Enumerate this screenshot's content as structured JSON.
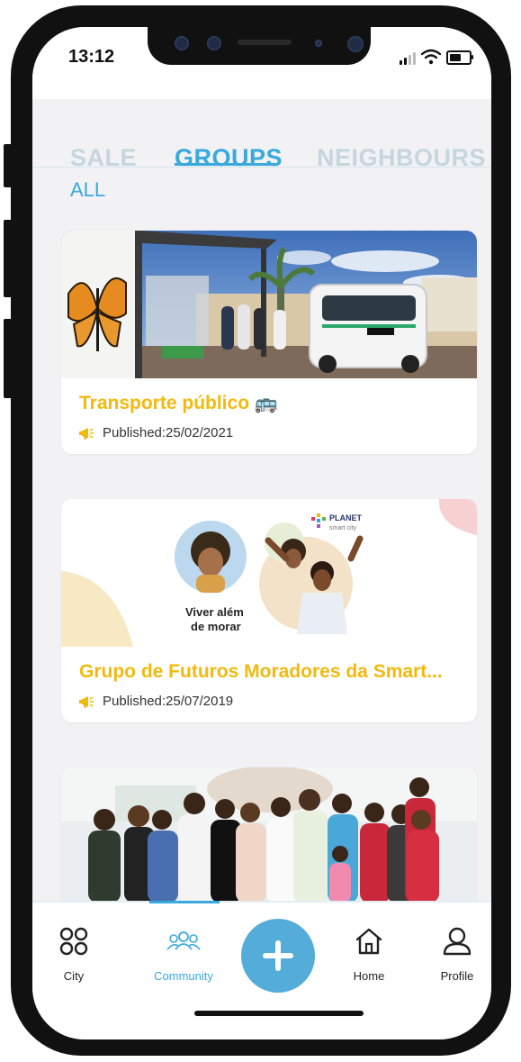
{
  "status": {
    "time": "13:12"
  },
  "tabs": [
    {
      "label": "SALE"
    },
    {
      "label": "GROUPS"
    },
    {
      "label": "NEIGHBOURS"
    }
  ],
  "filter": {
    "label": "ALL"
  },
  "cards": [
    {
      "title": "Transporte público 🚌",
      "published": "Published:25/02/2021"
    },
    {
      "title": "Grupo de Futuros Moradores da Smart...",
      "published": "Published:25/07/2019",
      "logo_line1": "PLANET",
      "logo_line2": "smart city",
      "slogan_line1": "Viver além",
      "slogan_line2": "de morar"
    },
    {
      "title": "",
      "published": ""
    }
  ],
  "nav": {
    "items": [
      {
        "label": "City"
      },
      {
        "label": "Community"
      },
      {
        "label": "Home"
      },
      {
        "label": "Profile"
      }
    ]
  },
  "colors": {
    "accent": "#39a9de",
    "title": "#f2b90f",
    "inactive_tab": "#c6d6df",
    "fab": "#54acd9"
  }
}
